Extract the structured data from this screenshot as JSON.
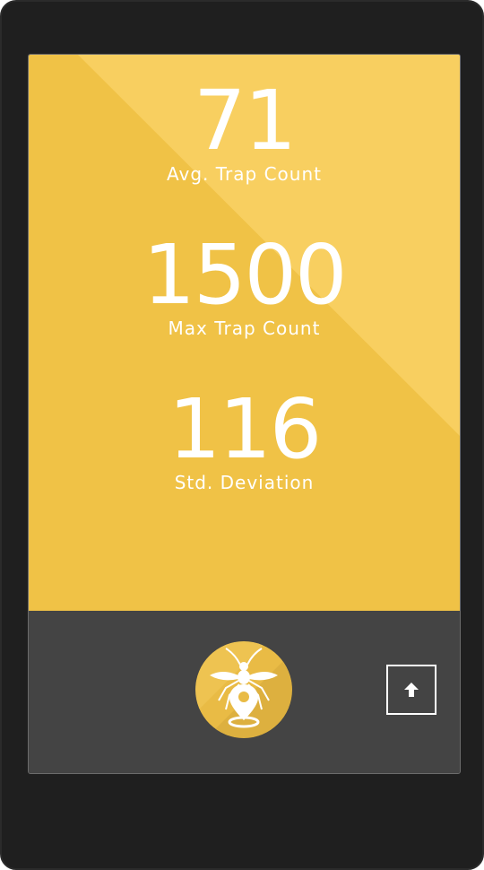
{
  "stats": [
    {
      "value": "71",
      "label": "Avg. Trap Count"
    },
    {
      "value": "1500",
      "label": "Max Trap Count"
    },
    {
      "value": "116",
      "label": "Std. Deviation"
    }
  ],
  "bottom_bar": {
    "logo_icon": "mosquito-location-pin-icon",
    "scroll_button_icon": "arrow-up-icon"
  },
  "colors": {
    "accent": "#f0c246",
    "accent_light": "#f8cf60",
    "bar": "#444444",
    "device_frame": "#1f1f1f"
  }
}
